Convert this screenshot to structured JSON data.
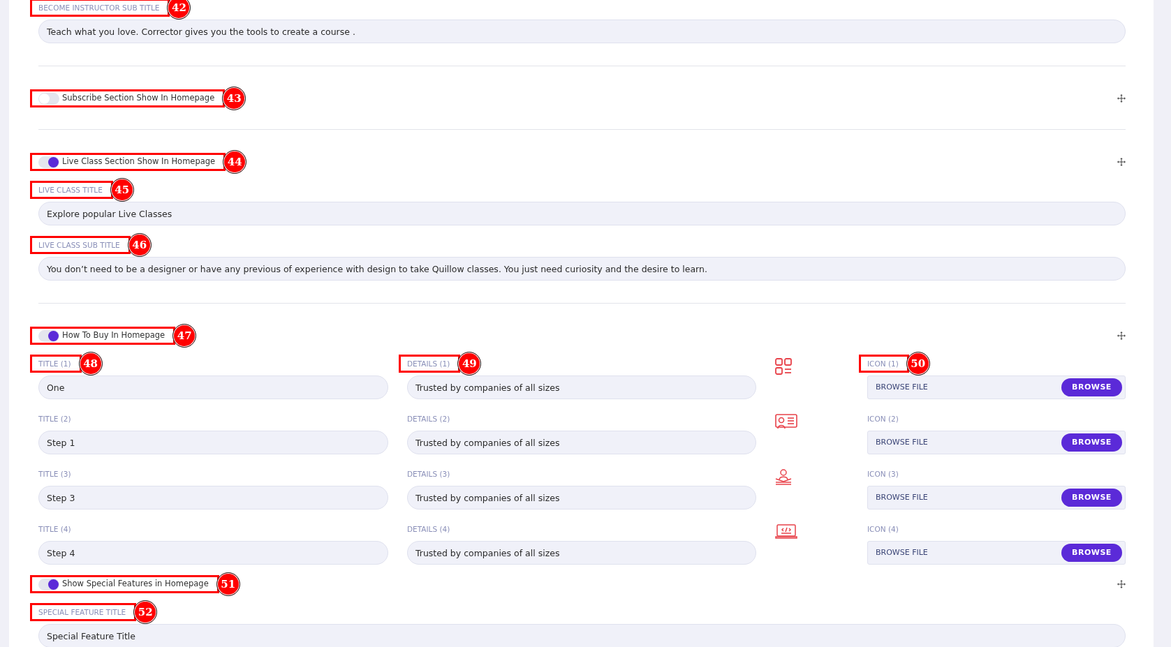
{
  "blocks": [
    {
      "divider_above": false,
      "fields": [
        {
          "label": "BECOME INSTRUCTOR SUB TITLE",
          "callout": "42",
          "value": "Teach what you love. Corrector gives you the tools to create a course ."
        }
      ]
    },
    {
      "divider_above": true,
      "toggle": {
        "label": "Subscribe Section Show In Homepage",
        "on": false,
        "callout": "43"
      }
    },
    {
      "divider_above": true,
      "toggle": {
        "label": "Live Class Section Show In Homepage",
        "on": true,
        "callout": "44"
      },
      "fields": [
        {
          "label": "LIVE CLASS TITLE",
          "callout": "45",
          "value": "Explore popular Live Classes"
        },
        {
          "label": "LIVE CLASS SUB TITLE",
          "callout": "46",
          "value": "You don’t need to be a designer or have any previous of experience with design to take Quillow classes. You just need curiosity and the desire to learn."
        }
      ]
    },
    {
      "divider_above": true,
      "toggle": {
        "label": "How To Buy In Homepage",
        "on": true,
        "callout": "47"
      },
      "steps": [
        {
          "title_label": "TITLE (1)",
          "title_callout": "48",
          "title": "One",
          "details_label": "DETAILS (1)",
          "details_callout": "49",
          "details": "Trusted by companies of all sizes",
          "icon_label": "ICON (1)",
          "icon_callout": "50",
          "file_text": "BROWSE FILE",
          "button": "BROWSE"
        },
        {
          "title_label": "TITLE (2)",
          "title": "Step 1",
          "details_label": "DETAILS (2)",
          "details": "Trusted by companies of all sizes",
          "icon_label": "ICON (2)",
          "file_text": "BROWSE FILE",
          "button": "BROWSE"
        },
        {
          "title_label": "TITLE (3)",
          "title": "Step 3",
          "details_label": "DETAILS (3)",
          "details": "Trusted by companies of all sizes",
          "icon_label": "ICON (3)",
          "file_text": "BROWSE FILE",
          "button": "BROWSE"
        },
        {
          "title_label": "TITLE (4)",
          "title": "Step 4",
          "details_label": "DETAILS (4)",
          "details": "Trusted by companies of all sizes",
          "icon_label": "ICON (4)",
          "file_text": "BROWSE FILE",
          "button": "BROWSE"
        }
      ]
    },
    {
      "divider_above": false,
      "toggle": {
        "label": "Show Special Features in Homepage",
        "on": true,
        "callout": "51"
      },
      "fields": [
        {
          "label": "SPECIAL FEATURE TITLE",
          "callout": "52",
          "value": "Special Feature Title"
        }
      ]
    }
  ]
}
